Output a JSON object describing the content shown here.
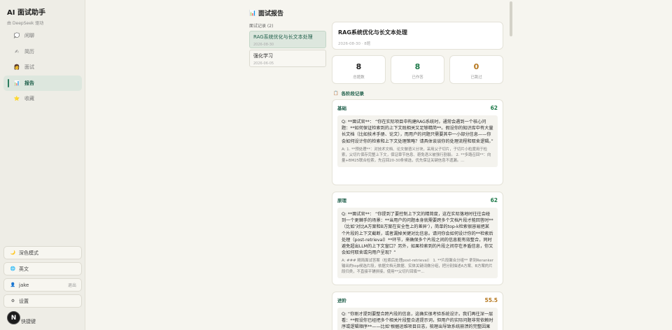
{
  "app": {
    "title": "AI 面试助手",
    "subtitle": "由 DeepSeek 驱动"
  },
  "nav": [
    {
      "label": "闲聊",
      "icon": "chat-bubble-icon",
      "glyph": "💭",
      "active": false
    },
    {
      "label": "简历",
      "icon": "resume-icon",
      "glyph": "✍",
      "active": false
    },
    {
      "label": "面试",
      "icon": "interview-icon",
      "glyph": "👩",
      "active": false
    },
    {
      "label": "报告",
      "icon": "report-chart-icon",
      "glyph": "📊",
      "active": true
    },
    {
      "label": "收藏",
      "icon": "star-icon",
      "glyph": "⭐",
      "active": false
    }
  ],
  "bottom": {
    "dark_mode": "深色模式",
    "language": "英文",
    "user": "jake",
    "logout": "退出",
    "settings": "设置",
    "shortcuts": "快捷键",
    "avatar_letter": "N"
  },
  "report": {
    "title": "面试报告",
    "records_header": "面试记录 (2)",
    "records": [
      {
        "title": "RAG系统优化与长文本处理",
        "date": "2026-08-30",
        "active": true
      },
      {
        "title": "强化学习",
        "date": "2026-06-05",
        "active": false
      }
    ],
    "detail": {
      "title": "RAG系统优化与长文本处理",
      "meta": "2026-08-30 · 8题"
    },
    "stats": [
      {
        "value": "8",
        "label": "总题数",
        "color": "#222222"
      },
      {
        "value": "8",
        "label": "已作答",
        "color": "#1f7a4a"
      },
      {
        "value": "0",
        "label": "已跳过",
        "color": "#b5761c"
      }
    ],
    "section_label": "各阶段记录",
    "questions": [
      {
        "stage": "基础",
        "score": "62",
        "q": "Q: **面试官**： “你在实际项目中构建RAG系统时，通常会遇到一个核心问题：**如何保证检索到的上下文既相关又足够精简**。假设你的知识库中有大量长文档（比如技术手册、论文），而用户的问题只需要其中一小部分信息——你会如何设计你的检索和上下文处理策略？请具体谈谈你的处理流程和取舍逻辑。”",
        "a": "A: 1. **预处理**：对技术文档、论文做语义分块，采用父子切片，子切片小粒度用于检索，父切片保存完整上下文，保证章节信息、避免语义被强行割裂。 2. **多路召回**：向量+BM25联合检索，先召回20-30条候选，优先保证关键信息不遗漏。..."
      },
      {
        "stage": "原理",
        "score": "62",
        "q": "Q: **面试官**： “你提到了要控制上下文的精简度，这在实际落地时往往会碰到一个更棘手的场景：**当用户的问题本身就需要跨多个文档片段才能回答时**（比如‘对比A方案和B方案在安全性上的差异’），简单的top-k检索很容易把某个片段的上下文截断，或者漏掉关键对比信息。请问你会如何设计你的**检索后处理（post-retrieval）**环节，来确保多个片段之间的信息能有效整合，同时避免超出LLM的上下文窗口？另外，如果检索到的片段之间存在矛盾信息，你又会如何取舍或向用户呈现？”",
        "a": "A: ### 精简面试答案（检索后处理post-retrieval） 1. **片段聚合分组** 拿到Reranker输出的top候选片段，依据文档元数据、实体关键词做分组，把分别描述A方案、B方案的片段归类，不直接平铺拼接，使用**父切片回填**..."
      },
      {
        "stage": "进阶",
        "score": "55.5",
        "q": "Q: “你刚才提到要整合跨片段的信息，这确实很考验系统设计。我们再往深一层看：**假设你已经把多个相关片段整合进提示词，但用户的实际问题非常依赖时序或逻辑顺序**——比如‘根据运维项目日志，梳理出导致系统崩溃的完整因果链’...",
        "a": ""
      }
    ]
  }
}
